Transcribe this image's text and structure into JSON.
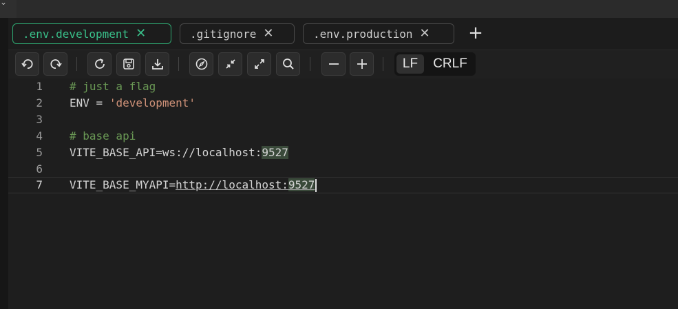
{
  "tabs": [
    {
      "label": ".env.development",
      "active": true
    },
    {
      "label": ".gitignore",
      "active": false
    },
    {
      "label": ".env.production",
      "active": false
    }
  ],
  "add_tab_icon": "plus-icon",
  "toolbar": {
    "buttons": [
      "undo-icon",
      "redo-icon",
      "reload-icon",
      "save-icon",
      "download-icon",
      "compass-icon",
      "collapse-icon",
      "expand-icon",
      "search-icon",
      "zoom-out-icon",
      "zoom-in-icon"
    ],
    "eol_options": [
      "LF",
      "CRLF"
    ],
    "eol_selected": "LF"
  },
  "editor": {
    "lines": [
      {
        "n": "1",
        "text": "# just a flag"
      },
      {
        "n": "2",
        "key": "ENV",
        "op": " = ",
        "value": "'development'"
      },
      {
        "n": "3",
        "text": ""
      },
      {
        "n": "4",
        "text": "# base api"
      },
      {
        "n": "5",
        "key": "VITE_BASE_API=ws://localhost:",
        "port": "9527"
      },
      {
        "n": "6",
        "text": ""
      },
      {
        "n": "7",
        "key": "VITE_BASE_MYAPI=",
        "url": "http://localhost:",
        "port": "9527"
      }
    ],
    "current_line": "7"
  },
  "colors": {
    "accent": "#39c08a",
    "comment": "#6a9955",
    "string": "#ce9178"
  }
}
